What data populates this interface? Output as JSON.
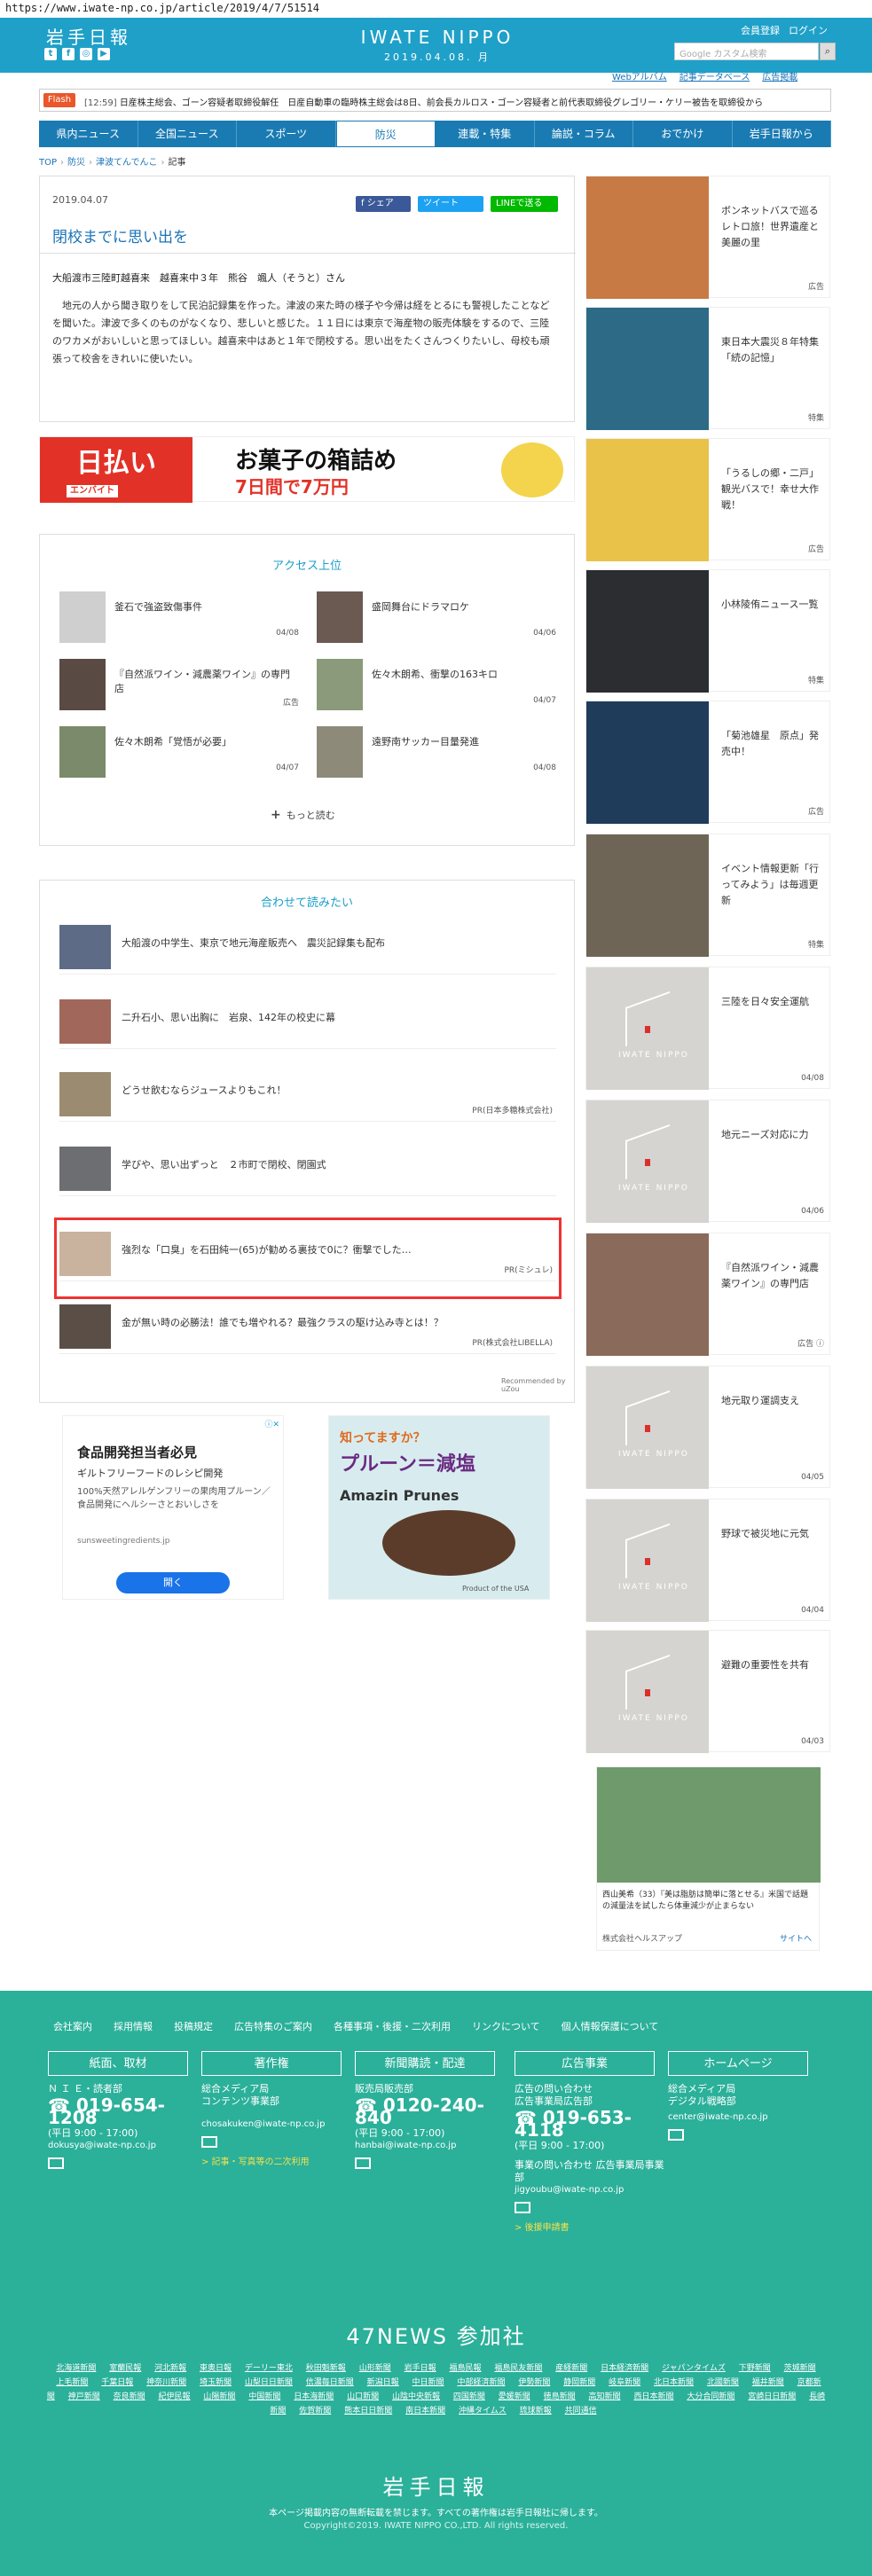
{
  "url": "https://www.iwate-np.co.jp/article/2019/4/7/51514",
  "header": {
    "logo_ja": "岩手日報",
    "logo_en": "IWATE NIPPO",
    "date": "2019.04.08. 月",
    "register": "会員登録",
    "login": "ログイン",
    "search_placeholder": "Google カスタム検索",
    "subnav": [
      "Webアルバム",
      "記事データベース",
      "広告掲載"
    ]
  },
  "flash": {
    "label": "Flash",
    "time": "[12:59]",
    "text": "日産株主総会、ゴーン容疑者取締役解任　日産自動車の臨時株主総会は8日、前会長カルロス・ゴーン容疑者と前代表取締役グレゴリー・ケリー被告を取締役から"
  },
  "nav": [
    "県内ニュース",
    "全国ニュース",
    "スポーツ",
    "防災",
    "連載・特集",
    "論説・コラム",
    "おでかけ",
    "岩手日報から"
  ],
  "breadcrumb": [
    "TOP",
    "防災",
    "津波てんでんこ",
    "記事"
  ],
  "article": {
    "date": "2019.04.07",
    "title": "閉校までに思い出を",
    "share": [
      "f シェア",
      "ツイート",
      "LINEで送る"
    ],
    "author": "大船渡市三陸町越喜来　越喜来中３年　熊谷　颯人（そうと）さん",
    "body": "地元の人から聞き取りをして民泊記録集を作った。津波の来た時の様子や今帰は経をとるにも警視したことなどを聞いた。津波で多くのものがなくなり、悲しいと感じた。１１日には東京で海産物の販売体験をするので、三陸のワカメがおいしいと思ってほしい。越喜来中はあと１年で閉校する。思い出をたくさんつくりたいし、母校も頑張って校舎をきれいに使いたい。"
  },
  "ad_banner": {
    "left": "日払い",
    "left_sub": "エンバイト",
    "main": "お菓子の箱詰め",
    "sub": "7日間で7万円"
  },
  "access": {
    "heading": "アクセス上位",
    "items": [
      {
        "title": "釜石で強盗致傷事件",
        "date": "04/08"
      },
      {
        "title": "盛岡舞台にドラマロケ",
        "date": "04/06"
      },
      {
        "title": "『自然派ワイン・減農薬ワイン』の専門店",
        "date": "広告"
      },
      {
        "title": "佐々木朗希、衝撃の163キロ",
        "date": "04/07"
      },
      {
        "title": "佐々木朗希「覚悟が必要」",
        "date": "04/07"
      },
      {
        "title": "遠野南サッカー目量発進",
        "date": "04/08"
      }
    ],
    "more": "もっと読む"
  },
  "recommend": {
    "heading": "合わせて読みたい",
    "items": [
      {
        "title": "大船渡の中学生、東京で地元海産販売へ　震災記録集も配布",
        "pr": ""
      },
      {
        "title": "二升石小、思い出胸に　岩泉、142年の校史に幕",
        "pr": ""
      },
      {
        "title": "どうせ飲むならジュースよりもこれ！",
        "pr": "PR(日本多糖株式会社)"
      },
      {
        "title": "学びや、思い出ずっと　２市町で閉校、閉園式",
        "pr": ""
      },
      {
        "title": "強烈な「口臭」を石田純一(65)が勧める裏技で0に？衝撃でした…",
        "pr": "PR(ミシュレ)"
      },
      {
        "title": "金が無い時の必勝法！誰でも増やれる？最強クラスの駆け込み寺とは！？",
        "pr": "PR(株式会社LIBELLA)"
      }
    ],
    "credit": "Recommended by uZou"
  },
  "gad": {
    "h": "食品開発担当者必見",
    "s": "ギルトフリーフードのレシピ開発",
    "d": "100%天然アレルゲンフリーの果肉用プルーン／食品開発にヘルシーさとおいしさを",
    "u": "sunsweetingredients.jp",
    "btn": "開く"
  },
  "gad2": {
    "h": "知ってますか？",
    "h2": "プルーン＝減塩",
    "am": "Amazin Prunes",
    "foot": "Product of the USA"
  },
  "side": [
    {
      "title": "ボンネットバスで巡るレトロ旅！世界遺産と美麗の里",
      "tag": "広告"
    },
    {
      "title": "東日本大震災８年特集「続の記憶」",
      "tag": "特集"
    },
    {
      "title": "「うるしの郷・二戸」観光バスで！幸せ大作戦！",
      "tag": "広告"
    },
    {
      "title": "小林陵侑ニュース一覧",
      "tag": "特集"
    },
    {
      "title": "「菊池雄星　原点」発売中！",
      "tag": "広告"
    },
    {
      "title": "イベント情報更新「行ってみよう」は毎週更新",
      "tag": "特集"
    },
    {
      "title": "三陸を日々安全運航",
      "tag": "04/08"
    },
    {
      "title": "地元ニーズ対応に力",
      "tag": "04/06"
    },
    {
      "title": "『自然派ワイン・減農薬ワイン』の専門店",
      "tag": "広告 ⓘ"
    },
    {
      "title": "地元取り運調支え",
      "tag": "04/05"
    },
    {
      "title": "野球で被災地に元気",
      "tag": "04/04"
    },
    {
      "title": "避難の重要性を共有",
      "tag": "04/03"
    }
  ],
  "sidead": {
    "caption": "西山美希（33）『美は脂肪は簡単に落とせる』米国で話題の減量法を試したら体重減少が止まらない",
    "brand": "株式会社ヘルスアップ",
    "link": "サイトへ"
  },
  "footer": {
    "links": [
      "会社案内",
      "採用情報",
      "投稿規定",
      "広告特集のご案内",
      "各種事項・後援・二次利用",
      "リンクについて",
      "個人情報保護について"
    ],
    "boxes": [
      "紙面、取材",
      "著作権",
      "新聞購読・配達",
      "広告事業",
      "ホームページ"
    ],
    "cols": [
      {
        "l1": "Ｎ Ｉ Ｅ・読者部",
        "l2": "",
        "tel": "019-654-1208",
        "hours": "(平日 9:00 - 17:00)",
        "mail": "dokusya@iwate-np.co.jp",
        "link": ""
      },
      {
        "l1": "総合メディア局",
        "l2": "コンテンツ事業部",
        "tel": "",
        "hours": "",
        "mail": "chosakuken@iwate-np.co.jp",
        "link": "> 記事・写真等の二次利用"
      },
      {
        "l1": "販売局販売部",
        "l2": "",
        "tel": "0120-240-840",
        "hours": "(平日 9:00 - 17:00)",
        "mail": "hanbai@iwate-np.co.jp",
        "link": ""
      },
      {
        "l1": "広告の問い合わせ",
        "l2": "広告事業局広告部",
        "tel": "019-653-4118",
        "hours": "(平日 9:00 - 17:00)",
        "mail": "",
        "link": "> 後援申請書"
      },
      {
        "l1": "総合メディア局",
        "l2": "デジタル戦略部",
        "tel": "",
        "hours": "",
        "mail": "center@iwate-np.co.jp",
        "link": ""
      }
    ],
    "col4_extra": "事業の問い合わせ 広告事業局事業部",
    "col4_mail": "jigyoubu@iwate-np.co.jp",
    "n47": "47NEWS 参加社",
    "papers": [
      "北海道新聞",
      "室蘭民報",
      "河北新報",
      "東奥日報",
      "デーリー東北",
      "秋田魁新報",
      "山形新聞",
      "岩手日報",
      "福島民報",
      "福島民友新聞",
      "産経新聞",
      "日本経済新聞",
      "ジャパンタイムズ",
      "下野新聞",
      "茨城新聞",
      "上毛新聞",
      "千葉日報",
      "神奈川新聞",
      "埼玉新聞",
      "山梨日日新聞",
      "信濃毎日新聞",
      "新潟日報",
      "中日新聞",
      "中部経済新聞",
      "伊勢新聞",
      "静岡新聞",
      "岐阜新聞",
      "北日本新聞",
      "北國新聞",
      "福井新聞",
      "京都新聞",
      "神戸新聞",
      "奈良新聞",
      "紀伊民報",
      "山陽新聞",
      "中国新聞",
      "日本海新聞",
      "山口新聞",
      "山陰中央新報",
      "四国新聞",
      "愛媛新聞",
      "徳島新聞",
      "高知新聞",
      "西日本新聞",
      "大分合同新聞",
      "宮崎日日新聞",
      "長崎新聞",
      "佐賀新聞",
      "熊本日日新聞",
      "南日本新聞",
      "沖縄タイムス",
      "琉球新報",
      "共同通信"
    ],
    "flogo": "岩手日報",
    "note": "本ページ掲載内容の無断転載を禁じます。すべての著作権は岩手日報社に帰します。",
    "copy": "Copyright©2019. IWATE NIPPO CO.,LTD. All rights reserved."
  }
}
